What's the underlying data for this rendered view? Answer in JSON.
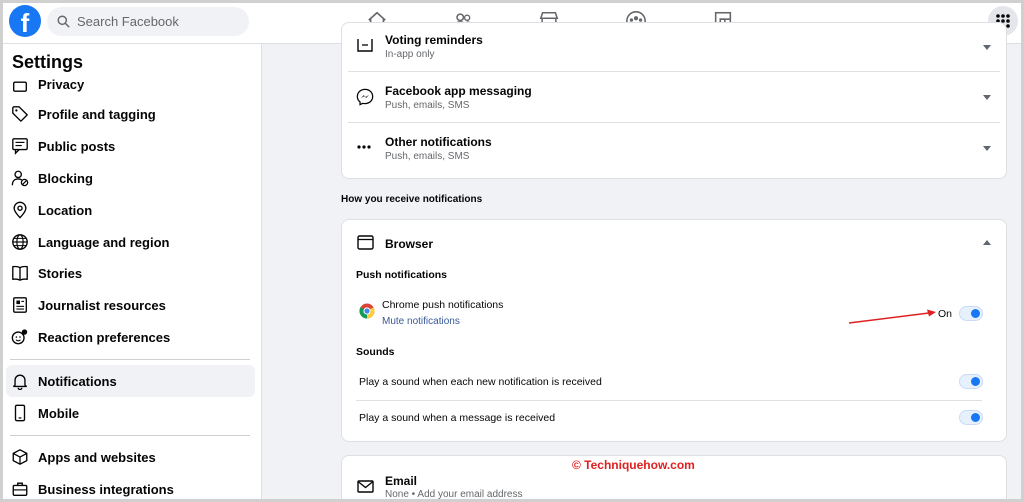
{
  "topbar": {
    "search_placeholder": "Search Facebook",
    "nav_icons": [
      "home-icon",
      "friends-icon",
      "marketplace-icon",
      "groups-icon",
      "gaming-icon"
    ],
    "brand_color": "#1877f2"
  },
  "sidebar": {
    "title": "Settings",
    "items": [
      {
        "label": "Privacy",
        "icon": "lock-icon"
      },
      {
        "label": "Profile and tagging",
        "icon": "tag-icon"
      },
      {
        "label": "Public posts",
        "icon": "public-posts-icon"
      },
      {
        "label": "Blocking",
        "icon": "blocking-icon"
      },
      {
        "label": "Location",
        "icon": "location-pin-icon"
      },
      {
        "label": "Language and region",
        "icon": "globe-icon"
      },
      {
        "label": "Stories",
        "icon": "book-icon"
      },
      {
        "label": "Journalist resources",
        "icon": "newspaper-icon"
      },
      {
        "label": "Reaction preferences",
        "icon": "reaction-icon"
      },
      {
        "label": "Notifications",
        "icon": "bell-icon",
        "active": true
      },
      {
        "label": "Mobile",
        "icon": "phone-icon"
      },
      {
        "label": "Apps and websites",
        "icon": "cube-icon"
      },
      {
        "label": "Business integrations",
        "icon": "business-icon"
      }
    ]
  },
  "main": {
    "top_rows": [
      {
        "title": "Voting reminders",
        "subtitle": "In-app only",
        "icon": "ballot-box-icon"
      },
      {
        "title": "Facebook app messaging",
        "subtitle": "Push, emails, SMS",
        "icon": "messenger-icon"
      },
      {
        "title": "Other notifications",
        "subtitle": "Push, emails, SMS",
        "icon": "more-dots-icon"
      }
    ],
    "receive_heading": "How you receive notifications",
    "browser": {
      "title": "Browser",
      "push_heading": "Push notifications",
      "chrome_label": "Chrome push notifications",
      "mute_link": "Mute notifications",
      "on_label": "On",
      "sounds_heading": "Sounds",
      "sound_each": "Play a sound when each new notification is received",
      "sound_message": "Play a sound when a message is received"
    },
    "email": {
      "title": "Email",
      "subtitle": "None • Add your email address"
    }
  },
  "watermark": "© Techniquehow.com",
  "annotation_color": "#e02020"
}
